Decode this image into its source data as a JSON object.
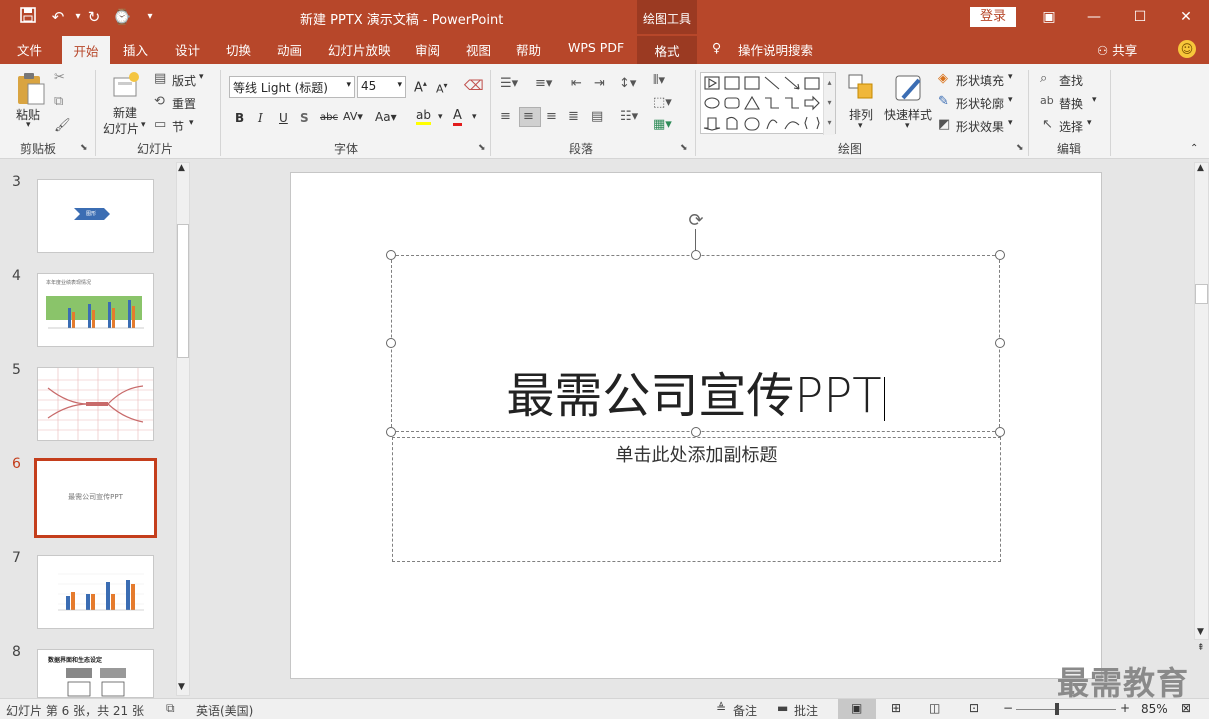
{
  "window": {
    "title": "新建 PPTX 演示文稿 - PowerPoint",
    "context_tool": "绘图工具",
    "login_label": "登录"
  },
  "tabs": [
    {
      "label": "文件"
    },
    {
      "label": "开始"
    },
    {
      "label": "插入"
    },
    {
      "label": "设计"
    },
    {
      "label": "切换"
    },
    {
      "label": "动画"
    },
    {
      "label": "幻灯片放映"
    },
    {
      "label": "审阅"
    },
    {
      "label": "视图"
    },
    {
      "label": "帮助"
    },
    {
      "label": "WPS PDF"
    },
    {
      "label": "格式"
    }
  ],
  "tell_me": "操作说明搜索",
  "share": "共享",
  "ribbon": {
    "clipboard": {
      "paste": "粘贴",
      "group": "剪贴板"
    },
    "slides": {
      "new_slide": "新建",
      "new_slide2": "幻灯片",
      "layout": "版式",
      "reset": "重置",
      "section": "节",
      "group": "幻灯片"
    },
    "font": {
      "name": "等线 Light (标题)",
      "size": "45",
      "group": "字体"
    },
    "paragraph": {
      "group": "段落"
    },
    "drawing": {
      "arrange": "排列",
      "quick_styles": "快速样式",
      "fill": "形状填充",
      "outline": "形状轮廓",
      "effects": "形状效果",
      "group": "绘图"
    },
    "editing": {
      "find": "查找",
      "replace": "替换",
      "select": "选择",
      "group": "编辑"
    }
  },
  "thumbnails": [
    {
      "num": "3",
      "text": "图形"
    },
    {
      "num": "4",
      "text": "本年度业绩表现情况"
    },
    {
      "num": "5",
      "text": ""
    },
    {
      "num": "6",
      "text": "最需公司宣传PPT"
    },
    {
      "num": "7",
      "text": ""
    },
    {
      "num": "8",
      "text": "数据界面和生态设定"
    }
  ],
  "slide": {
    "title": "最需公司宣传PPT",
    "subtitle_placeholder": "单击此处添加副标题"
  },
  "status": {
    "slide_info": "幻灯片 第 6 张，共 21 张",
    "language": "英语(美国)",
    "notes": "备注",
    "comments": "批注",
    "zoom": "85%",
    "zoom_fraction": 0.85
  },
  "watermark": "最需教育",
  "colors": {
    "accent": "#b7472a",
    "selected_thumb": "#c43e1c"
  }
}
